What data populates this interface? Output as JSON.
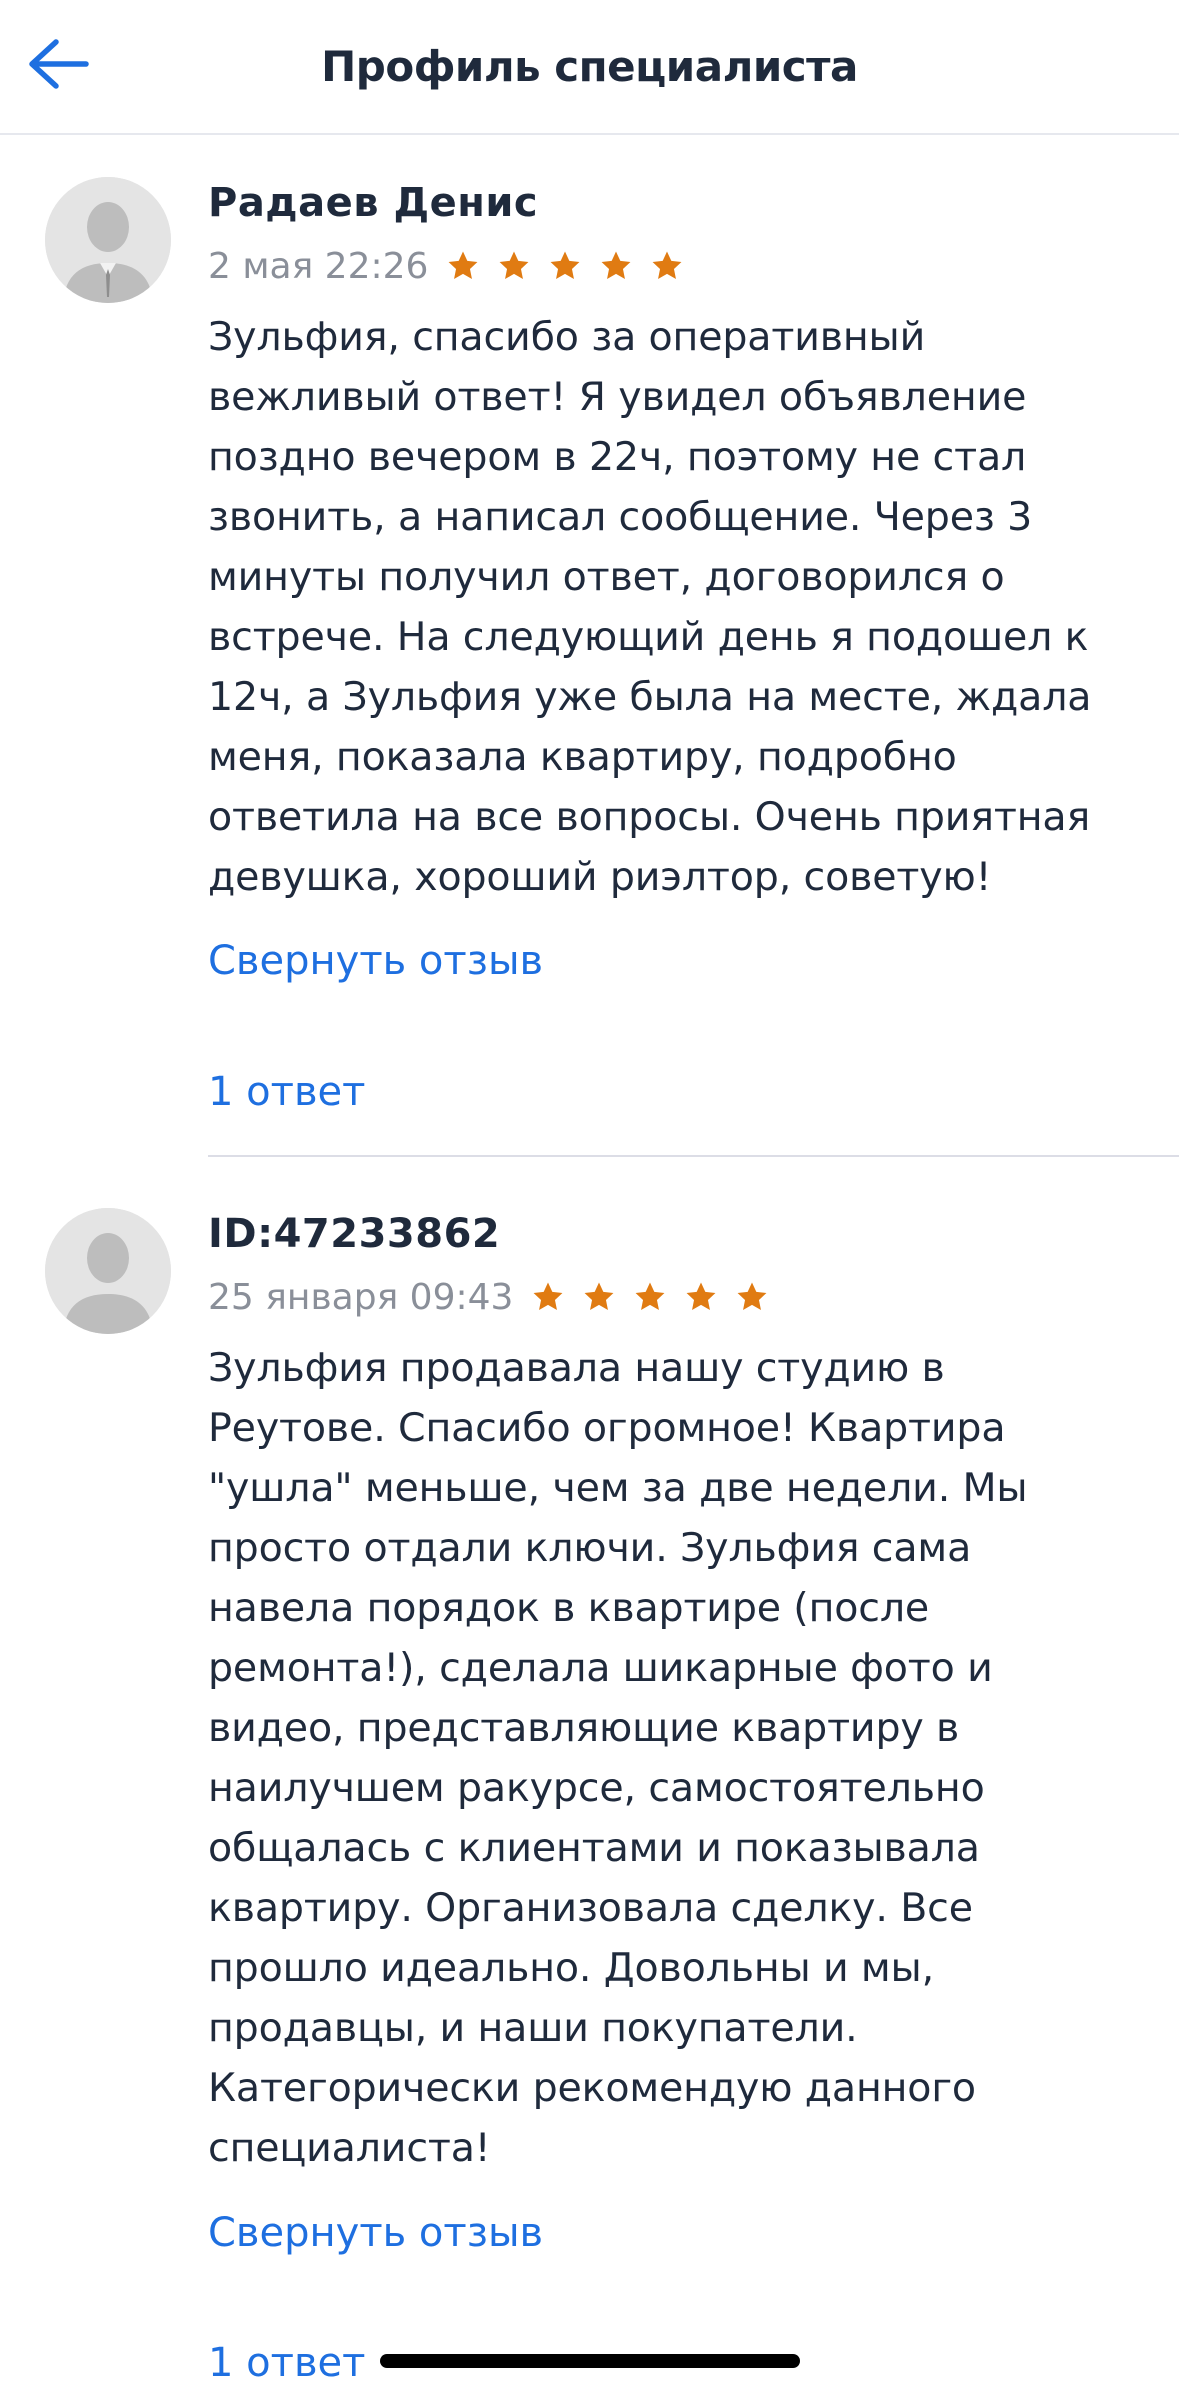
{
  "header": {
    "title": "Профиль специалиста"
  },
  "reviews": [
    {
      "author": "Радаев Денис",
      "date": "2 мая 22:26",
      "rating": 5,
      "paragraph": [
        "Зульфия, спасибо за оперативный",
        "вежливый ответ! Я увидел объявление",
        "поздно вечером в 22ч, поэтому не стал",
        "звонить, а написал сообщение. Через 3",
        "минуты получил ответ, договорился о",
        "встрече. На следующий день я подошел к",
        "12ч, а Зульфия уже была на месте, ждала",
        "меня, показала квартиру, подробно",
        "ответила на все вопросы. Очень приятная",
        "девушка, хороший риэлтор, советую!"
      ],
      "collapse_label": "Свернуть отзыв",
      "replies_label": "1 ответ"
    },
    {
      "author": "ID:47233862",
      "date": "25 января 09:43",
      "rating": 5,
      "paragraph": [
        "Зульфия продавала нашу студию в",
        "Реутове. Спасибо огромное! Квартира",
        "\"ушла\" меньше, чем за две недели. Мы",
        "просто отдали ключи. Зульфия сама",
        "навела порядок в квартире (после",
        "ремонта!), сделала шикарные фото и",
        "видео, представляющие квартиру в",
        "наилучшем ракурсе, самостоятельно",
        "общалась с клиентами и показывала",
        "квартиру. Организовала сделку. Все",
        "прошло идеально. Довольны и мы,",
        "продавцы, и наши покупатели.",
        "Категорически рекомендую данного",
        "специалиста!"
      ],
      "collapse_label": "Свернуть отзыв",
      "replies_label": "1 ответ"
    }
  ],
  "colors": {
    "accent": "#1e6fe0",
    "star": "#e07b12",
    "text": "#1f2a3c",
    "muted": "#8a8f99"
  },
  "icons": {
    "back": "arrow-left-icon",
    "avatar": "person-silhouette-icon",
    "star": "star-icon"
  }
}
